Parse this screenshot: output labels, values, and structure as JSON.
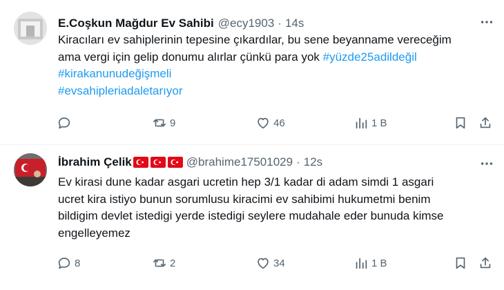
{
  "tweets": [
    {
      "author_name": "E.Coşkun Mağdur Ev Sahibi",
      "handle": "@ecy1903",
      "separator": "·",
      "time": "14s",
      "lines": [
        {
          "text": "Kiracıları ev sahiplerinin tepesine çıkardılar, bu sene beyanname vereceğim"
        },
        {
          "text": "ama vergi için gelip donumu alırlar çünkü para yok ",
          "hashtag": "#yüzde25adildeğil"
        },
        {
          "hashtag": "#kirakanunudeğişmeli"
        },
        {
          "hashtag": "#evsahipleriadaletarıyor"
        }
      ],
      "metrics": {
        "replies": "",
        "reposts": "9",
        "likes": "46",
        "views": "1 B"
      }
    },
    {
      "author_name": "İbrahim Çelik",
      "flags": [
        "turkey-flag",
        "turkey-flag",
        "turkey-flag"
      ],
      "handle": "@brahime17501029",
      "separator": "·",
      "time": "12s",
      "lines": [
        {
          "text": "Ev kirasi dune kadar asgari ucretin hep 3/1 kadar di adam simdi 1 asgari"
        },
        {
          "text": "ucret kira istiyo bunun sorumlusu kiracimi ev sahibimi hukumetmi benim"
        },
        {
          "text": "bildigim devlet istedigi yerde istedigi seylere mudahale eder bunuda kimse"
        },
        {
          "text": "engelleyemez"
        }
      ],
      "metrics": {
        "replies": "8",
        "reposts": "2",
        "likes": "34",
        "views": "1 B"
      }
    }
  ],
  "icons": {
    "reply": "reply-icon",
    "repost": "repost-icon",
    "like": "heart-icon",
    "views": "views-icon",
    "bookmark": "bookmark-icon",
    "share": "share-icon",
    "more": "more-icon"
  },
  "colors": {
    "hashtag": "#1d9bf0",
    "secondary_text": "#536471",
    "primary_text": "#0f1419",
    "flag_red": "#e30a17"
  }
}
